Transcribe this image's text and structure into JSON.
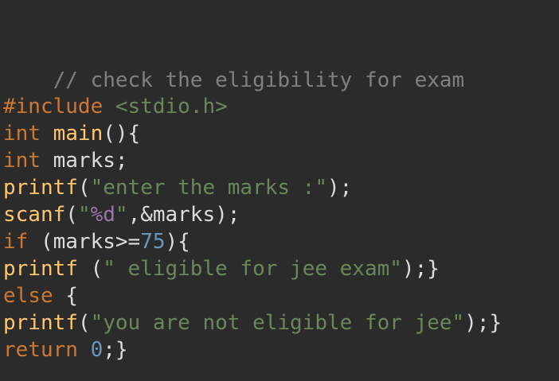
{
  "code": {
    "comment": "// check the eligibility for exam",
    "include_kw": "#include",
    "include_header": "<stdio.h>",
    "l_main_type": "int",
    "l_main_func": "main",
    "l_main_rest": "(){",
    "l_marks_type": "int",
    "l_marks_rest": "marks;",
    "l_printf1_func": "printf",
    "l_printf1_open": "(",
    "l_printf1_str": "\"enter the marks :\"",
    "l_printf1_close": ");",
    "l_scanf_func": "scanf",
    "l_scanf_open": "(",
    "l_scanf_q1": "\"",
    "l_scanf_fmt": "%d",
    "l_scanf_q2": "\"",
    "l_scanf_rest": ",&marks);",
    "l_if_kw": "if",
    "l_if_rest1": " (marks>=",
    "l_if_num": "75",
    "l_if_rest2": "){",
    "l_printf2_func": "printf",
    "l_printf2_open": " (",
    "l_printf2_str": "\" eligible for jee exam\"",
    "l_printf2_close": ");}",
    "l_else_kw": "else",
    "l_else_rest": " {",
    "l_printf3_func": "printf",
    "l_printf3_open": "(",
    "l_printf3_str": "\"you are not eligible for jee\"",
    "l_printf3_close": ");}",
    "l_return_kw": "return",
    "l_return_num": " 0",
    "l_return_rest": ";}"
  },
  "colors": {
    "background": "#2b2b2b",
    "comment": "#808080",
    "keyword": "#cc7832",
    "function": "#ffc66d",
    "string": "#6a8759",
    "format": "#9876aa",
    "number": "#6897bb",
    "text": "#dcdcdc"
  }
}
